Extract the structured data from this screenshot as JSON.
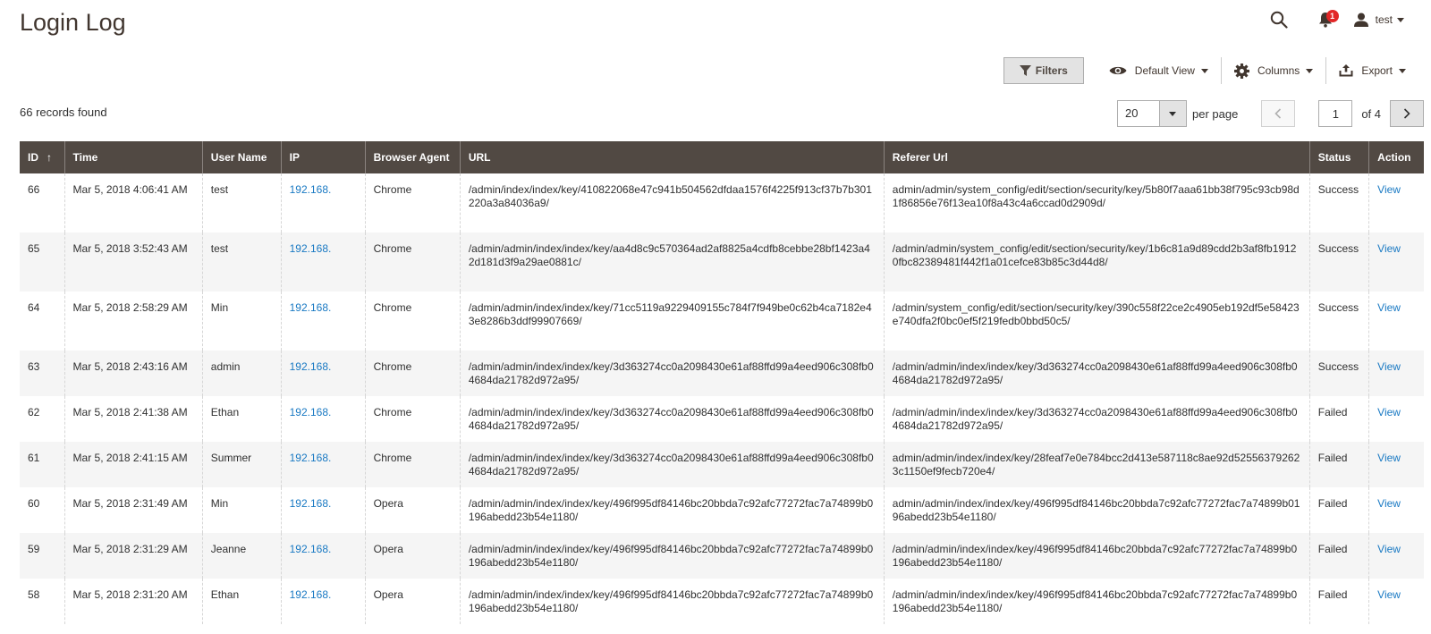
{
  "page": {
    "title": "Login Log"
  },
  "header": {
    "notification_count": "1",
    "user_name": "test"
  },
  "toolbar": {
    "filters_label": "Filters",
    "view_label": "Default View",
    "columns_label": "Columns",
    "export_label": "Export"
  },
  "grid": {
    "records_found": "66 records found",
    "per_page_value": "20",
    "per_page_label": "per page",
    "current_page": "1",
    "total_pages_label": "of 4",
    "sort_indicator": "↑",
    "columns": [
      "ID",
      "Time",
      "User Name",
      "IP",
      "Browser Agent",
      "URL",
      "Referer Url",
      "Status",
      "Action"
    ],
    "rows": [
      {
        "id": "66",
        "time": "Mar 5, 2018 4:06:41 AM",
        "user": "test",
        "ip": "192.168.",
        "browser": "Chrome",
        "url": "/admin/index/index/key/410822068e47c941b504562dfdaa1576f4225f913cf37b7b301220a3a84036a9/",
        "referer": "admin/admin/system_config/edit/section/security/key/5b80f7aaa61bb38f795c93cb98d1f86856e76f13ea10f8a43c4a6ccad0d2909d/",
        "status": "Success",
        "action": "View"
      },
      {
        "id": "65",
        "time": "Mar 5, 2018 3:52:43 AM",
        "user": "test",
        "ip": "192.168.",
        "browser": "Chrome",
        "url": "/admin/admin/index/index/key/aa4d8c9c570364ad2af8825a4cdfb8cebbe28bf1423a42d181d3f9a29ae0881c/",
        "referer": "/admin/admin/system_config/edit/section/security/key/1b6c81a9d89cdd2b3af8fb19120fbc82389481f442f1a01cefce83b85c3d44d8/",
        "status": "Success",
        "action": "View"
      },
      {
        "id": "64",
        "time": "Mar 5, 2018 2:58:29 AM",
        "user": "Min",
        "ip": "192.168.",
        "browser": "Chrome",
        "url": "/admin/admin/index/index/key/71cc5119a9229409155c784f7f949be0c62b4ca7182e43e8286b3ddf99907669/",
        "referer": "/admin/system_config/edit/section/security/key/390c558f22ce2c4905eb192df5e58423e740dfa2f0bc0ef5f219fedb0bbd50c5/",
        "status": "Success",
        "action": "View"
      },
      {
        "id": "63",
        "time": "Mar 5, 2018 2:43:16 AM",
        "user": "admin",
        "ip": "192.168.",
        "browser": "Chrome",
        "url": "/admin/admin/index/index/key/3d363274cc0a2098430e61af88ffd99a4eed906c308fb04684da21782d972a95/",
        "referer": "/admin/admin/index/index/key/3d363274cc0a2098430e61af88ffd99a4eed906c308fb04684da21782d972a95/",
        "status": "Success",
        "action": "View"
      },
      {
        "id": "62",
        "time": "Mar 5, 2018 2:41:38 AM",
        "user": "Ethan",
        "ip": "192.168.",
        "browser": "Chrome",
        "url": "/admin/admin/index/index/key/3d363274cc0a2098430e61af88ffd99a4eed906c308fb04684da21782d972a95/",
        "referer": "/admin/admin/index/index/key/3d363274cc0a2098430e61af88ffd99a4eed906c308fb04684da21782d972a95/",
        "status": "Failed",
        "action": "View"
      },
      {
        "id": "61",
        "time": "Mar 5, 2018 2:41:15 AM",
        "user": "Summer",
        "ip": "192.168.",
        "browser": "Chrome",
        "url": "/admin/admin/index/index/key/3d363274cc0a2098430e61af88ffd99a4eed906c308fb04684da21782d972a95/",
        "referer": "admin/admin/index/index/key/28feaf7e0e784bcc2d413e587118c8ae92d525563792623c1150ef9fecb720e4/",
        "status": "Failed",
        "action": "View"
      },
      {
        "id": "60",
        "time": "Mar 5, 2018 2:31:49 AM",
        "user": "Min",
        "ip": "192.168.",
        "browser": "Opera",
        "url": "/admin/admin/index/index/key/496f995df84146bc20bbda7c92afc77272fac7a74899b0196abedd23b54e1180/",
        "referer": "admin/admin/index/index/key/496f995df84146bc20bbda7c92afc77272fac7a74899b0196abedd23b54e1180/",
        "status": "Failed",
        "action": "View"
      },
      {
        "id": "59",
        "time": "Mar 5, 2018 2:31:29 AM",
        "user": "Jeanne",
        "ip": "192.168.",
        "browser": "Opera",
        "url": "/admin/admin/index/index/key/496f995df84146bc20bbda7c92afc77272fac7a74899b0196abedd23b54e1180/",
        "referer": "/admin/admin/index/index/key/496f995df84146bc20bbda7c92afc77272fac7a74899b0196abedd23b54e1180/",
        "status": "Failed",
        "action": "View"
      },
      {
        "id": "58",
        "time": "Mar 5, 2018 2:31:20 AM",
        "user": "Ethan",
        "ip": "192.168.",
        "browser": "Opera",
        "url": "/admin/admin/index/index/key/496f995df84146bc20bbda7c92afc77272fac7a74899b0196abedd23b54e1180/",
        "referer": "/admin/admin/index/index/key/496f995df84146bc20bbda7c92afc77272fac7a74899b0196abedd23b54e1180/",
        "status": "Failed",
        "action": "View"
      }
    ]
  },
  "colors": {
    "header_bg": "#514943",
    "link": "#1979c3",
    "success": "#2f7d32",
    "failed": "#e22626",
    "badge": "#e22626"
  },
  "icons": {
    "search": "search-icon",
    "notifications": "bell-icon",
    "user": "user-icon",
    "filters": "funnel-icon",
    "view": "eye-icon",
    "columns": "gear-icon",
    "export": "upload-icon",
    "prev": "chevron-left-icon",
    "next": "chevron-right-icon"
  }
}
